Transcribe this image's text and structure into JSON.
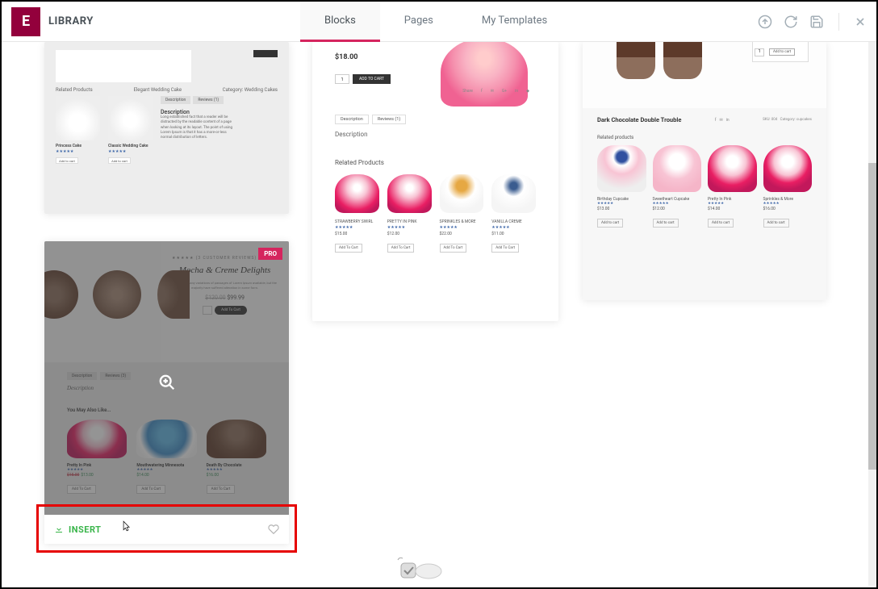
{
  "header": {
    "title": "LIBRARY",
    "tabs": {
      "blocks": "Blocks",
      "pages": "Pages",
      "my_templates": "My Templates"
    }
  },
  "card1": {
    "related_label": "Related Products",
    "style_label": "Elegant Wedding Cake",
    "cat_label": "Category: Wedding Cakes",
    "tab_desc": "Description",
    "tab_rev": "Reviews (1)",
    "desc_title": "Description",
    "prod1": "Princess Cake",
    "prod2": "Classic Wedding Cake",
    "btn": "Add to cart"
  },
  "card2": {
    "price": "$18.00",
    "qty": "1",
    "addcart": "ADD TO CART",
    "share": "Share",
    "tab_desc": "Description",
    "tab_rev": "Reviews (1)",
    "desc": "Description",
    "related": "Related Products",
    "p1": "STRAWBERRY SWIRL",
    "p1price": "$15.00",
    "p2": "PRETTY IN PINK",
    "p2price": "$12.00",
    "p3": "SPRINKLES & MORE",
    "p3price": "$22.00",
    "p4": "VANILLA CREME",
    "p4price": "$11.00",
    "btn": "Add To Cart"
  },
  "card3": {
    "qty": "1",
    "side_btn": "Add to cart",
    "title": "Dark Chocolate Double Trouble",
    "sku": "SKU: 004",
    "category": "Category: cupcakes",
    "related": "Related products",
    "p1": "Birthday Cupcake",
    "p1price": "$13.00",
    "p2": "Sweetheart Cupcake",
    "p2price": "$12.00",
    "p3": "Pretty In Pink",
    "p3price": "$14.00",
    "p4": "Sprinkles & More",
    "p4price": "$16.00",
    "btn": "Add to cart"
  },
  "card4": {
    "pro": "PRO",
    "brand": "★★★★★   (3 CUSTOMER REVIEWS)",
    "title": "Mocha & Creme Delights",
    "hprice": "$99.99",
    "hbtn": "Add To Cart",
    "tab_desc": "Description",
    "tab_rev": "Reviews (3)",
    "bdesc": "Description",
    "like": "You May Also Like...",
    "p1": "Pretty In Pink",
    "p1old": "$15.00",
    "p1price": "$13.00",
    "p2": "Mouthwatering Minnesota",
    "p2old": "",
    "p2price": "$14.00",
    "p3": "Death By Chocolate",
    "p3old": "",
    "p3price": "$16.00",
    "btn": "Add To Cart",
    "insert": "INSERT"
  }
}
